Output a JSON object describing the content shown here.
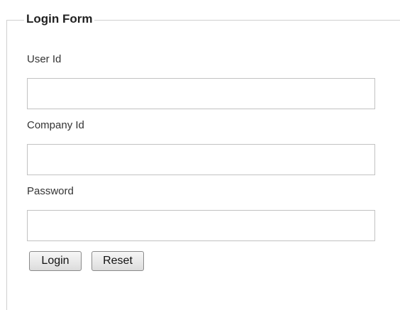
{
  "form": {
    "legend": "Login Form",
    "fields": [
      {
        "label": "User Id",
        "value": "",
        "placeholder": ""
      },
      {
        "label": "Company Id",
        "value": "",
        "placeholder": ""
      },
      {
        "label": "Password",
        "value": "",
        "placeholder": ""
      }
    ],
    "buttons": {
      "login": "Login",
      "reset": "Reset"
    }
  }
}
